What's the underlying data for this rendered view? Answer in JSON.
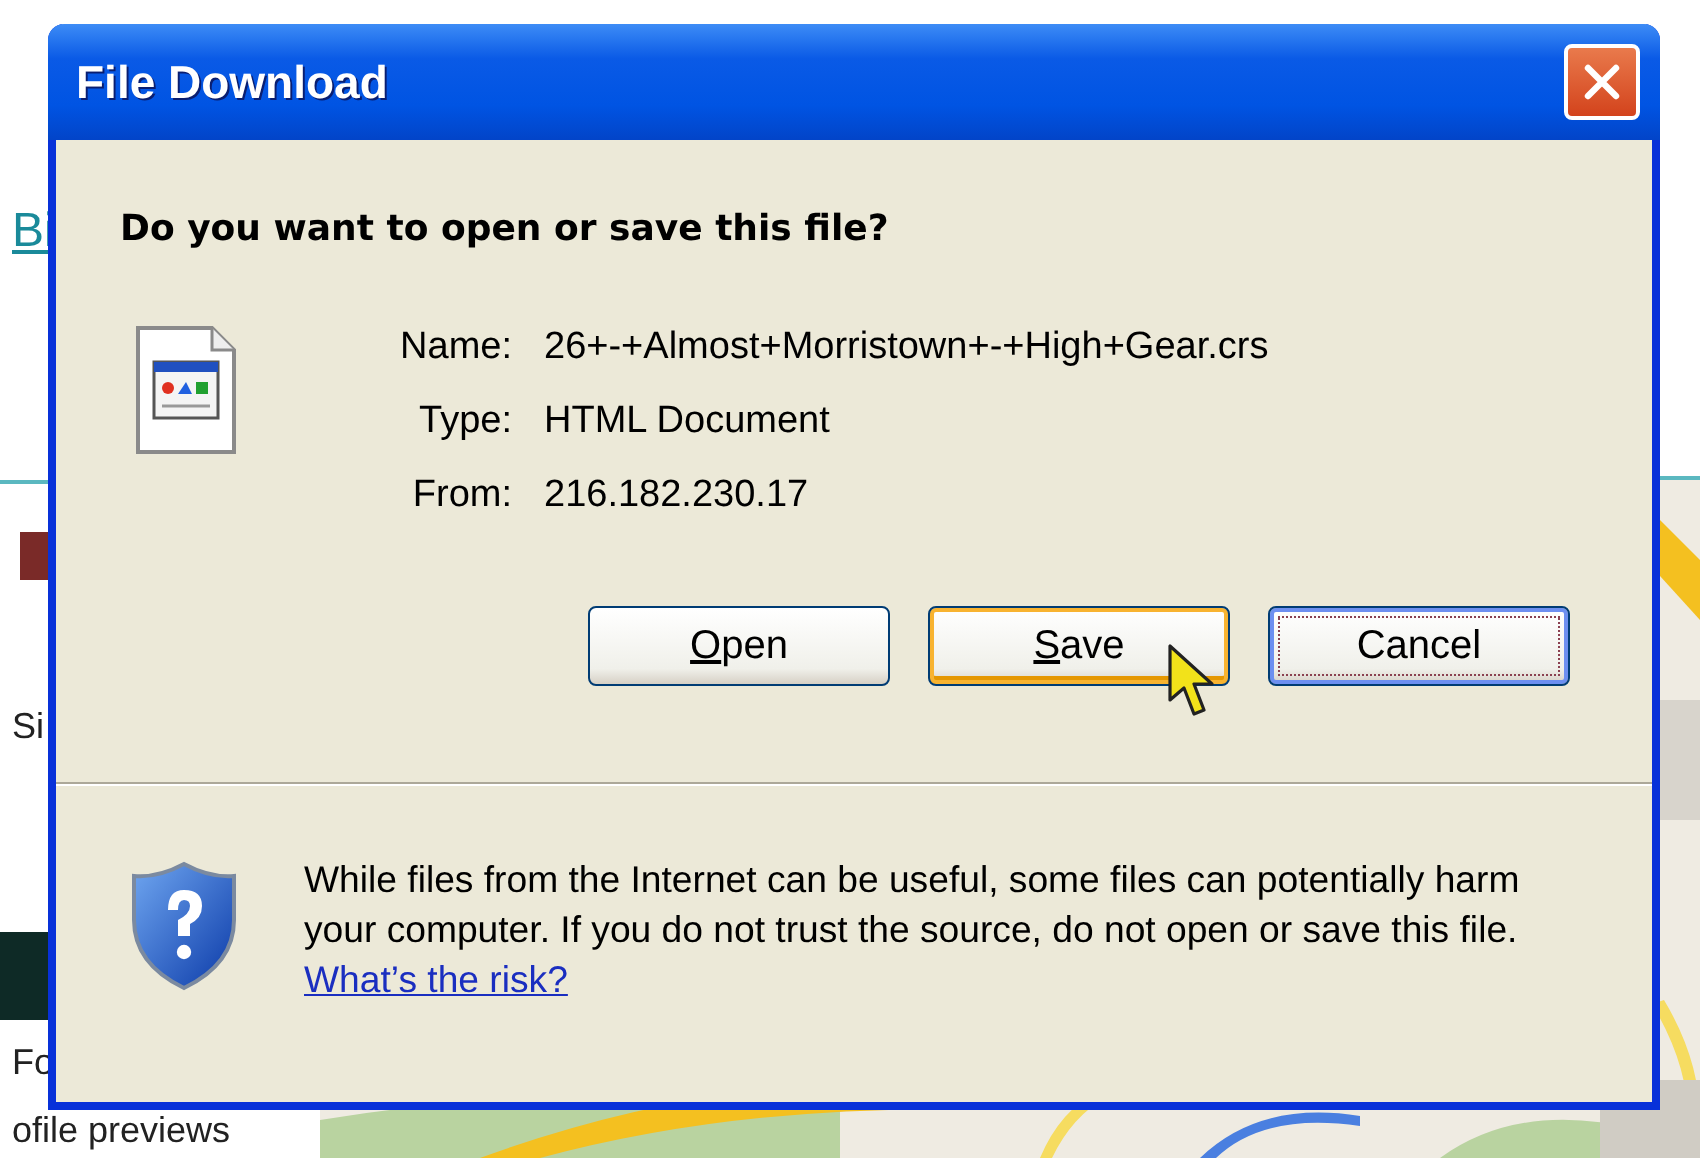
{
  "background": {
    "link": "Bi",
    "labels": [
      "Si",
      "Fo"
    ],
    "caption": "ofile previews"
  },
  "window": {
    "title": "File Download"
  },
  "question": "Do you want to open or save this file?",
  "details": [
    {
      "label": "Name:",
      "value": "26+-+Almost+Morristown+-+High+Gear.crs"
    },
    {
      "label": "Type:",
      "value": "HTML Document"
    },
    {
      "label": "From:",
      "value": "216.182.230.17"
    }
  ],
  "buttons": [
    {
      "access_key": "O",
      "rest": "pen",
      "hovered": false,
      "focused": false
    },
    {
      "access_key": "S",
      "rest": "ave",
      "hovered": true,
      "focused": false
    },
    {
      "rest": "Cancel",
      "hovered": false,
      "focused": true
    }
  ],
  "warning": {
    "text": "While files from the Internet can be useful, some files can potentially harm your computer. If you do not trust the source, do not open or save this file.",
    "link": "What’s the risk?"
  }
}
